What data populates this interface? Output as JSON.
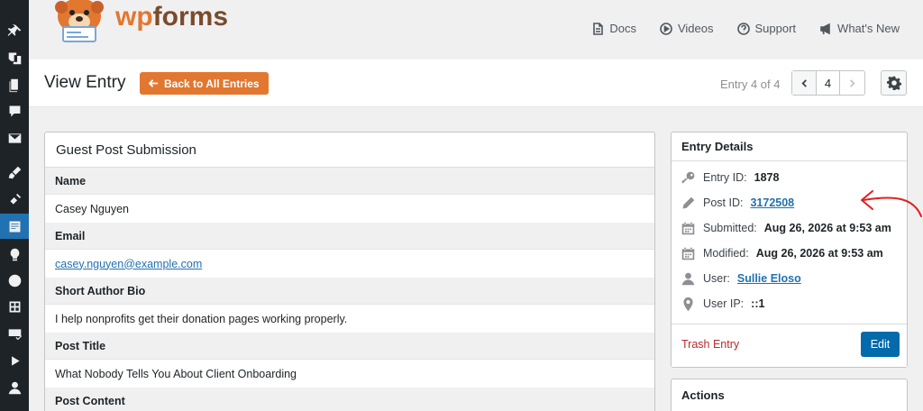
{
  "brand": {
    "logo_text": "wpforms",
    "accent": "#e27730"
  },
  "header_nav": [
    {
      "label": "Docs",
      "icon": "document-icon"
    },
    {
      "label": "Videos",
      "icon": "play-icon"
    },
    {
      "label": "Support",
      "icon": "question-icon"
    },
    {
      "label": "What's New",
      "icon": "megaphone-icon"
    }
  ],
  "sidebar": {
    "items": [
      "pin-icon",
      "media-icon",
      "pages-icon",
      "comments-icon",
      "email-icon",
      "appearance-icon",
      "plugins-icon",
      "wpforms-icon",
      "lightbulb-icon",
      "gear-circle-icon",
      "grid-icon",
      "mail-check-icon",
      "play-icon",
      "user-icon"
    ],
    "active": "wpforms-icon"
  },
  "title_bar": {
    "title": "View Entry",
    "back_label": "Back to All Entries",
    "entry_counter": "Entry 4 of 4",
    "current_page": "4"
  },
  "form": {
    "title": "Guest Post Submission",
    "fields": [
      {
        "label": "Name",
        "value": "Casey Nguyen",
        "is_link": false
      },
      {
        "label": "Email",
        "value": "casey.nguyen@example.com",
        "is_link": true
      },
      {
        "label": "Short Author Bio",
        "value": "I help nonprofits get their donation pages working properly.",
        "is_link": false
      },
      {
        "label": "Post Title",
        "value": "What Nobody Tells You About Client Onboarding",
        "is_link": false
      },
      {
        "label": "Post Content",
        "value": "",
        "is_link": false
      }
    ]
  },
  "entry_details": {
    "title": "Entry Details",
    "rows": [
      {
        "label": "Entry ID:",
        "value": "1878",
        "icon": "key-icon",
        "is_link": false
      },
      {
        "label": "Post ID:",
        "value": "3172508",
        "icon": "pencil-icon",
        "is_link": true
      },
      {
        "label": "Submitted:",
        "value": "Aug 26, 2026 at 9:53 am",
        "icon": "calendar-icon",
        "is_link": false
      },
      {
        "label": "Modified:",
        "value": "Aug 26, 2026 at 9:53 am",
        "icon": "calendar-icon",
        "is_link": false
      },
      {
        "label": "User:",
        "value": "Sullie Eloso",
        "icon": "user-icon",
        "is_link": true
      },
      {
        "label": "User IP:",
        "value": "::1",
        "icon": "location-icon",
        "is_link": false
      }
    ],
    "trash_label": "Trash Entry",
    "edit_label": "Edit"
  },
  "actions": {
    "title": "Actions"
  },
  "colors": {
    "sidebar_bg": "#1d2327",
    "sidebar_active": "#2271b1",
    "link": "#2271b1",
    "trash": "#b32d2e",
    "edit_button": "#036aab",
    "annotation": "#e02020"
  }
}
